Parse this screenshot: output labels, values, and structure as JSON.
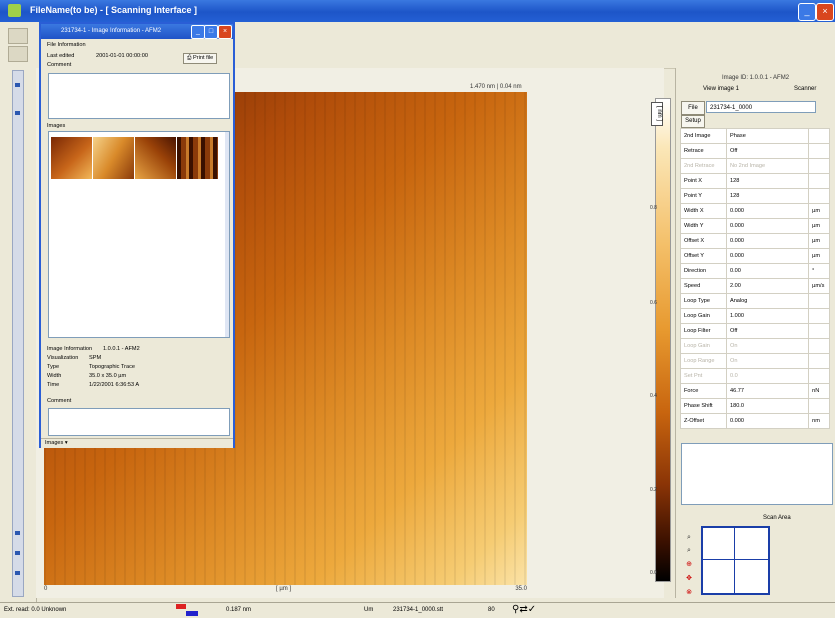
{
  "window": {
    "title": "FileName(to be) - [ Scanning Interface ]"
  },
  "image": {
    "top_label": "1.470 nm | 0.04 nm",
    "x_axis_start": "0",
    "x_axis_mid": "[ µm ]",
    "x_axis_end": "35.0"
  },
  "colorbar": {
    "label": "[ nm ]",
    "ticks": [
      "0.8",
      "0.6",
      "0.4",
      "0.2",
      "0.0"
    ]
  },
  "right_panel": {
    "image_id": "Image ID: 1.0.0.1 - AFM2",
    "view_image": "View image 1",
    "scanner": "Scanner",
    "file_button": "File",
    "file_name": "231734-1_0000",
    "setup_button": "Setup",
    "params": [
      {
        "name": "2nd Image",
        "value": "Phase",
        "unit": "",
        "disabled": false
      },
      {
        "name": "Retrace",
        "value": "Off",
        "unit": "",
        "disabled": false
      },
      {
        "name": "2nd Retrace",
        "value": "No 2nd Image",
        "unit": "",
        "disabled": true
      },
      {
        "name": "Point X",
        "value": "128",
        "unit": "",
        "disabled": false
      },
      {
        "name": "Point Y",
        "value": "128",
        "unit": "",
        "disabled": false
      },
      {
        "name": "Width X",
        "value": "0.000",
        "unit": "µm",
        "disabled": false
      },
      {
        "name": "Width Y",
        "value": "0.000",
        "unit": "µm",
        "disabled": false
      },
      {
        "name": "Offset X",
        "value": "0.000",
        "unit": "µm",
        "disabled": false
      },
      {
        "name": "Offset Y",
        "value": "0.000",
        "unit": "µm",
        "disabled": false
      },
      {
        "name": "Direction",
        "value": "0.00",
        "unit": "°",
        "disabled": false
      },
      {
        "name": "Speed",
        "value": "2.00",
        "unit": "µm/s",
        "disabled": false
      },
      {
        "name": "Loop Type",
        "value": "Analog",
        "unit": "",
        "disabled": false
      },
      {
        "name": "Loop Gain",
        "value": "1.000",
        "unit": "",
        "disabled": false
      },
      {
        "name": "Loop Filter",
        "value": "Off",
        "unit": "",
        "disabled": false
      },
      {
        "name": "Loop Gain",
        "value": "On",
        "unit": "",
        "disabled": true
      },
      {
        "name": "Loop Range",
        "value": "On",
        "unit": "",
        "disabled": true
      },
      {
        "name": "Set Pnt",
        "value": "0.0",
        "unit": "",
        "disabled": true
      },
      {
        "name": "Force",
        "value": "46.77",
        "unit": "nN",
        "disabled": false
      },
      {
        "name": "Phase Shift",
        "value": "180.0",
        "unit": "",
        "disabled": false
      },
      {
        "name": "Z-Offset",
        "value": "0.000",
        "unit": "nm",
        "disabled": false
      }
    ],
    "scan_area_title": "Scan Area"
  },
  "file_window": {
    "title": "231734-1 - Image Information - AFM2",
    "file_info_label": "File Information",
    "last_edited_label": "Last edited",
    "last_edited_value": "2001-01-01 00:00:00",
    "comment_label": "Comment",
    "print_button": "Print file",
    "images_label": "Images",
    "info": [
      {
        "k": "Image Information",
        "v": "1.0.0.1 - AFM2"
      },
      {
        "k": "Visualization",
        "v": "SPM"
      },
      {
        "k": "Type",
        "v": "Topographic Trace"
      },
      {
        "k": "Width",
        "v": "35.0 x 35.0 µm"
      },
      {
        "k": "Time",
        "v": "1/22/2001 6:36:53 A"
      }
    ],
    "comment2_label": "Comment",
    "footer": "Images  ▾"
  },
  "status": {
    "left": "Ext. read: 0.0 Unknown",
    "mid": "0.187 nm",
    "unit": "Um",
    "file": "231734-1_0000.stt",
    "zoom": "80"
  }
}
